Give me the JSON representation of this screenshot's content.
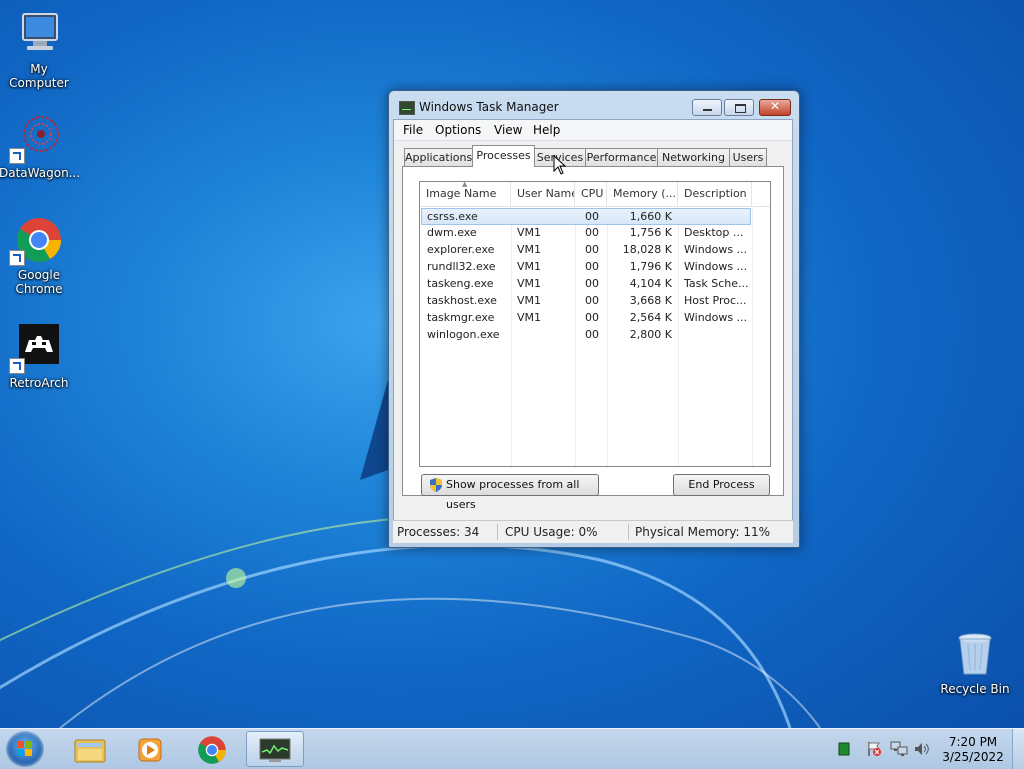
{
  "desktop": {
    "icons": [
      {
        "label": "My Computer"
      },
      {
        "label": "DataWagon..."
      },
      {
        "label": "Google Chrome"
      },
      {
        "label": "RetroArch"
      },
      {
        "label": "Recycle Bin"
      }
    ]
  },
  "window": {
    "title": "Windows Task Manager",
    "menu": [
      "File",
      "Options",
      "View",
      "Help"
    ],
    "tabs": [
      "Applications",
      "Processes",
      "Services",
      "Performance",
      "Networking",
      "Users"
    ],
    "active_tab": "Processes",
    "columns": [
      "Image Name",
      "User Name",
      "CPU",
      "Memory (...",
      "Description"
    ],
    "rows": [
      {
        "image": "csrss.exe",
        "user": "",
        "cpu": "00",
        "memory": "1,660 K",
        "desc": ""
      },
      {
        "image": "dwm.exe",
        "user": "VM1",
        "cpu": "00",
        "memory": "1,756 K",
        "desc": "Desktop ..."
      },
      {
        "image": "explorer.exe",
        "user": "VM1",
        "cpu": "00",
        "memory": "18,028 K",
        "desc": "Windows ..."
      },
      {
        "image": "rundll32.exe",
        "user": "VM1",
        "cpu": "00",
        "memory": "1,796 K",
        "desc": "Windows ..."
      },
      {
        "image": "taskeng.exe",
        "user": "VM1",
        "cpu": "00",
        "memory": "4,104 K",
        "desc": "Task Sche..."
      },
      {
        "image": "taskhost.exe",
        "user": "VM1",
        "cpu": "00",
        "memory": "3,668 K",
        "desc": "Host Proc..."
      },
      {
        "image": "taskmgr.exe",
        "user": "VM1",
        "cpu": "00",
        "memory": "2,564 K",
        "desc": "Windows ..."
      },
      {
        "image": "winlogon.exe",
        "user": "",
        "cpu": "00",
        "memory": "2,800 K",
        "desc": ""
      }
    ],
    "show_all_label": "Show processes from all users",
    "end_process_label": "End Process",
    "status": {
      "processes": "Processes: 34",
      "cpu": "CPU Usage: 0%",
      "memory": "Physical Memory: 11%"
    }
  },
  "taskbar": {
    "time": "7:20 PM",
    "date": "3/25/2022"
  },
  "colors": {
    "desktop_bg": "#1066c4",
    "selection": "#d6e7f9",
    "close_button": "#c2432b"
  }
}
